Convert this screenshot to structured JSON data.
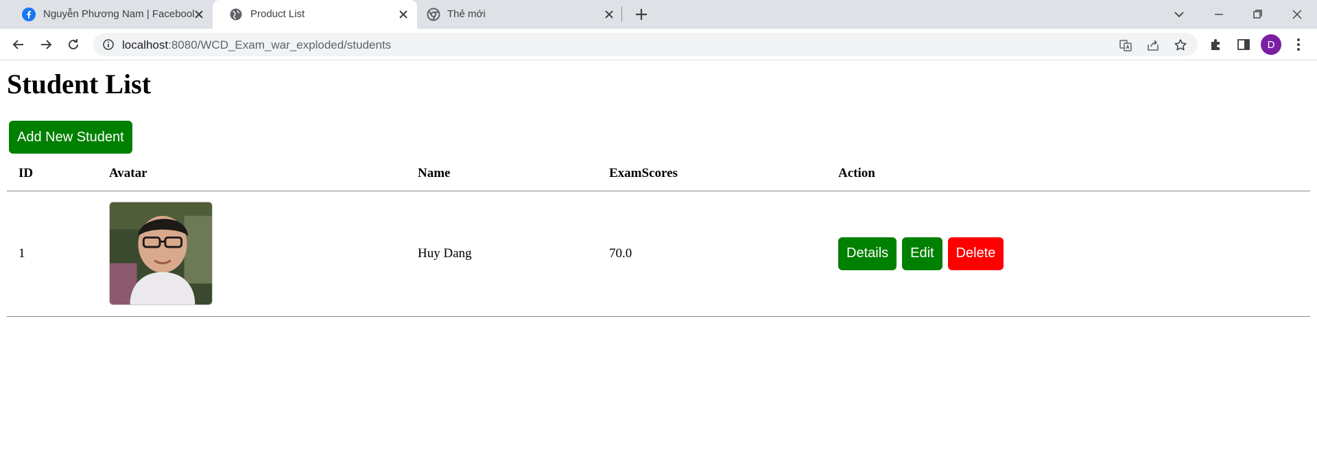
{
  "browser": {
    "tabs": [
      {
        "title": "Nguyễn Phương Nam | Facebook",
        "icon": "facebook-icon",
        "active": false
      },
      {
        "title": "Product List",
        "icon": "globe-icon",
        "active": true
      },
      {
        "title": "Thẻ mới",
        "icon": "chrome-icon",
        "active": false
      }
    ],
    "url_host": "localhost",
    "url_path": ":8080/WCD_Exam_war_exploded/students",
    "profile_initial": "D",
    "profile_color": "#7b1fa2"
  },
  "page": {
    "title": "Student List",
    "add_button_label": "Add New Student",
    "colors": {
      "primary": "#008000",
      "danger": "#ff0000"
    },
    "table": {
      "headers": {
        "id": "ID",
        "avatar": "Avatar",
        "name": "Name",
        "scores": "ExamScores",
        "action": "Action"
      },
      "rows": [
        {
          "id": "1",
          "name": "Huy Dang",
          "scores": "70.0",
          "actions": {
            "details": "Details",
            "edit": "Edit",
            "delete": "Delete"
          }
        }
      ]
    }
  }
}
